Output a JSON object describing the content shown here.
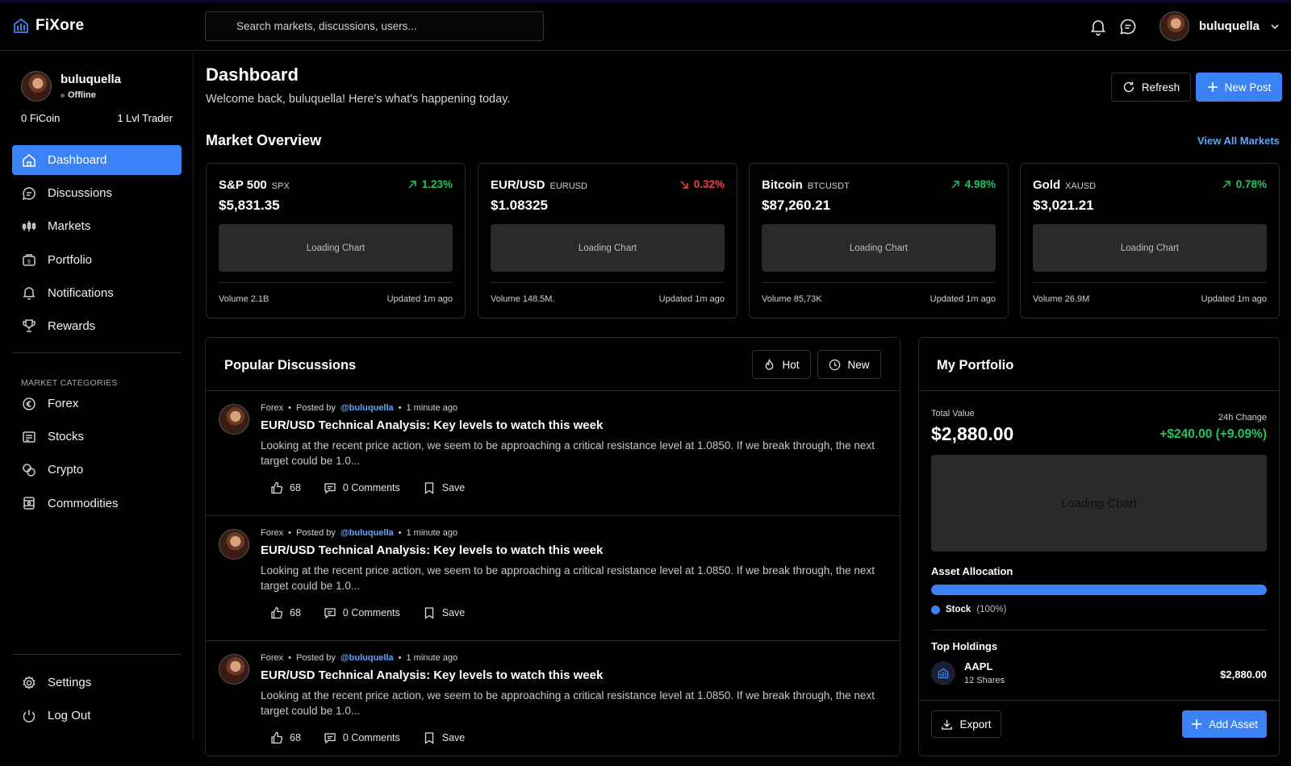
{
  "app": {
    "name": "FiXore"
  },
  "search": {
    "placeholder": "Search markets, discussions, users..."
  },
  "header": {
    "username": "buluquella"
  },
  "profile": {
    "name": "buluquella",
    "status": "Offline",
    "coins": "0 FiCoin",
    "level": "1 Lvl Trader"
  },
  "nav": {
    "main": [
      {
        "label": "Dashboard",
        "icon": "home-icon",
        "active": true
      },
      {
        "label": "Discussions",
        "icon": "chat-icon"
      },
      {
        "label": "Markets",
        "icon": "markets-icon"
      },
      {
        "label": "Portfolio",
        "icon": "briefcase-icon"
      },
      {
        "label": "Notifications",
        "icon": "bell-icon"
      },
      {
        "label": "Rewards",
        "icon": "trophy-icon"
      }
    ],
    "categories_title": "MARKET CATEGORIES",
    "categories": [
      {
        "label": "Forex",
        "icon": "currency-icon"
      },
      {
        "label": "Stocks",
        "icon": "stocks-icon"
      },
      {
        "label": "Crypto",
        "icon": "crypto-icon"
      },
      {
        "label": "Commodities",
        "icon": "commodities-icon"
      }
    ],
    "bottom": [
      {
        "label": "Settings",
        "icon": "gear-icon"
      },
      {
        "label": "Log Out",
        "icon": "power-icon"
      }
    ]
  },
  "dashboard": {
    "title": "Dashboard",
    "subtitle": "Welcome back, buluquella! Here's what's happening today.",
    "refresh_label": "Refresh",
    "new_post_label": "New Post"
  },
  "market_overview": {
    "title": "Market Overview",
    "view_all": "View All Markets",
    "cards": [
      {
        "name": "S&P 500",
        "symbol": "SPX",
        "change": "1.23%",
        "direction": "up",
        "price": "$5,831.35",
        "chart": "Loading Chart",
        "volume": "Volume 2.1B",
        "updated": "Updated 1m ago"
      },
      {
        "name": "EUR/USD",
        "symbol": "EURUSD",
        "change": "0.32%",
        "direction": "down",
        "price": "$1.08325",
        "chart": "Loading Chart",
        "volume": "Volume 148.5M.",
        "updated": "Updated 1m ago"
      },
      {
        "name": "Bitcoin",
        "symbol": "BTCUSDT",
        "change": "4.98%",
        "direction": "up",
        "price": "$87,260.21",
        "chart": "Loading Chart",
        "volume": "Volume 85,73K",
        "updated": "Updated 1m ago"
      },
      {
        "name": "Gold",
        "symbol": "XAUSD",
        "change": "0.78%",
        "direction": "up",
        "price": "$3,021.21",
        "chart": "Loading Chart",
        "volume": "Volume 26.9M",
        "updated": "Updated 1m ago"
      }
    ],
    "colors": {
      "up": "#22c55e",
      "down": "#ef4444"
    }
  },
  "discussions": {
    "title": "Popular Discussions",
    "hot_label": "Hot",
    "new_label": "New",
    "posts": [
      {
        "category": "Forex",
        "posted_by": "Posted by",
        "user": "@buluquella",
        "time": "1 minute ago",
        "title": "EUR/USD Technical Analysis: Key levels to watch this week",
        "body": "Looking at the recent price action, we seem to be approaching a critical resistance level at 1.0850. If we break through, the next target could be 1.0...",
        "likes": "68",
        "comments": "0 Comments",
        "save": "Save"
      },
      {
        "category": "Forex",
        "posted_by": "Posted by",
        "user": "@buluquella",
        "time": "1 minute ago",
        "title": "EUR/USD Technical Analysis: Key levels to watch this week",
        "body": "Looking at the recent price action, we seem to be approaching a critical resistance level at 1.0850. If we break through, the next target could be 1.0...",
        "likes": "68",
        "comments": "0 Comments",
        "save": "Save"
      },
      {
        "category": "Forex",
        "posted_by": "Posted by",
        "user": "@buluquella",
        "time": "1 minute ago",
        "title": "EUR/USD Technical Analysis: Key levels to watch this week",
        "body": "Looking at the recent price action, we seem to be approaching a critical resistance level at 1.0850. If we break through, the next target could be 1.0...",
        "likes": "68",
        "comments": "0 Comments",
        "save": "Save"
      }
    ]
  },
  "portfolio": {
    "title": "My Portfolio",
    "total_label": "Total Value",
    "total_value": "$2,880.00",
    "change_label": "24h Change",
    "change_value": "+$240.00 (+9.09%)",
    "chart": "Loading Chart",
    "allocation_label": "Asset Allocation",
    "allocation": [
      {
        "name": "Stock",
        "percent_label": "(100%)",
        "fraction": 1.0,
        "color": "#3b82f6"
      }
    ],
    "holdings_label": "Top Holdings",
    "holdings": [
      {
        "symbol": "AAPL",
        "shares": "12 Shares",
        "value": "$2,880.00"
      }
    ],
    "export_label": "Export",
    "add_asset_label": "Add Asset"
  }
}
